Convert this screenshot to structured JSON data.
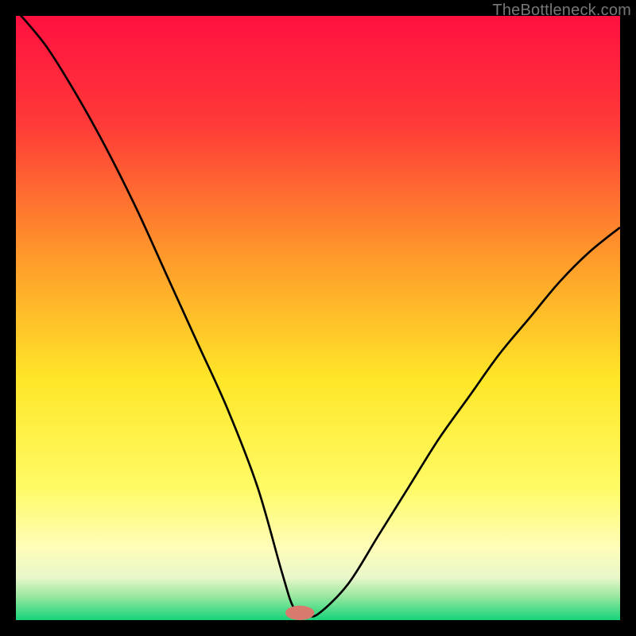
{
  "watermark": "TheBottleneck.com",
  "chart_data": {
    "type": "line",
    "title": "",
    "xlabel": "",
    "ylabel": "",
    "xlim": [
      0,
      100
    ],
    "ylim": [
      0,
      100
    ],
    "grid": false,
    "legend": false,
    "series": [
      {
        "name": "curve",
        "x": [
          0,
          5,
          10,
          15,
          20,
          25,
          30,
          35,
          40,
          44,
          46,
          48,
          50,
          55,
          60,
          65,
          70,
          75,
          80,
          85,
          90,
          95,
          100
        ],
        "values": [
          101,
          95,
          87,
          78,
          68,
          57,
          46,
          35,
          22,
          8,
          2,
          1,
          1,
          6,
          14,
          22,
          30,
          37,
          44,
          50,
          56,
          61,
          65
        ]
      }
    ],
    "marker": {
      "x": 47,
      "y": 1.2,
      "rx": 2.4,
      "ry": 1.2,
      "color": "#d97a6f"
    },
    "background_gradient": {
      "stops": [
        {
          "offset": 0.0,
          "color": "#ff1040"
        },
        {
          "offset": 0.18,
          "color": "#ff3a38"
        },
        {
          "offset": 0.4,
          "color": "#ff9a2a"
        },
        {
          "offset": 0.6,
          "color": "#ffe627"
        },
        {
          "offset": 0.78,
          "color": "#fffb65"
        },
        {
          "offset": 0.88,
          "color": "#fffdb8"
        },
        {
          "offset": 0.93,
          "color": "#e8f7ca"
        },
        {
          "offset": 0.96,
          "color": "#9be8a0"
        },
        {
          "offset": 1.0,
          "color": "#17d47a"
        }
      ]
    }
  }
}
